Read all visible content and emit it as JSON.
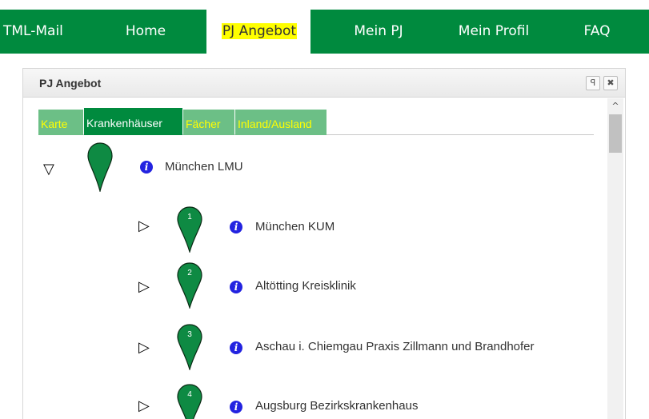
{
  "nav": {
    "items": [
      {
        "label": "TML-Mail"
      },
      {
        "label": "Home"
      },
      {
        "label": "PJ Angebot"
      },
      {
        "label": "Mein PJ"
      },
      {
        "label": "Mein Profil"
      },
      {
        "label": "FAQ"
      }
    ],
    "active_index": 2
  },
  "panel": {
    "title": "PJ Angebot",
    "restore_icon": "ꟼ",
    "close_icon": "✖"
  },
  "tabs": [
    {
      "label": "Karte",
      "active": false
    },
    {
      "label": "Krankenhäuser",
      "active": true
    },
    {
      "label": "Fächer",
      "active": false
    },
    {
      "label": "Inland/Ausland",
      "active": false
    }
  ],
  "tree": {
    "root": {
      "label": "München LMU",
      "expanded": true,
      "toggle": "▽"
    },
    "children": [
      {
        "number": "1",
        "label": "München KUM",
        "toggle": "▷"
      },
      {
        "number": "2",
        "label": "Altötting Kreisklinik",
        "toggle": "▷"
      },
      {
        "number": "3",
        "label": "Aschau i. Chiemgau Praxis Zillmann und Brandhofer",
        "toggle": "▷"
      },
      {
        "number": "4",
        "label": "Augsburg Bezirkskrankenhaus",
        "toggle": "▷"
      }
    ]
  },
  "info_glyph": "i",
  "scroll_up_glyph": "^",
  "colors": {
    "brand_green": "#008a3e",
    "tab_inactive": "#6cbf86",
    "highlight_yellow": "#ffff00",
    "info_blue": "#2323e0",
    "pin_green": "#0e8a43"
  }
}
